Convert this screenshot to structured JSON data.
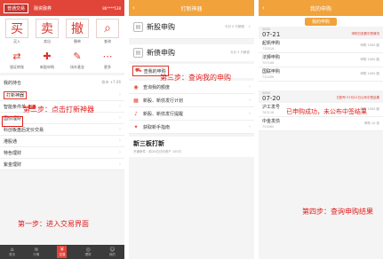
{
  "panel1": {
    "tabs": [
      "普通交易",
      "融资融券"
    ],
    "account": "86****538",
    "grid": [
      {
        "label": "买入",
        "char": "买",
        "icon": "buy-icon",
        "big": true
      },
      {
        "label": "卖出",
        "char": "卖",
        "icon": "sell-icon",
        "big": true
      },
      {
        "label": "撤单",
        "char": "撤",
        "icon": "cancel-order-icon",
        "big": true
      },
      {
        "label": "查询",
        "char": "⌕",
        "icon": "search-icon",
        "big": true
      },
      {
        "label": "银证转账",
        "char": "⇄",
        "icon": "transfer-icon",
        "big": false
      },
      {
        "label": "新股申购",
        "char": "✚",
        "icon": "ipo-icon",
        "big": false
      },
      {
        "label": "场外基金",
        "char": "✎",
        "icon": "fund-icon",
        "big": false
      },
      {
        "label": "更多",
        "char": "⋯",
        "icon": "more-icon",
        "big": false
      }
    ],
    "holding_title": "我的持仓",
    "holding_value": "收市 +7.06",
    "rows": [
      {
        "label": "打新神器",
        "sub": "",
        "tag": "",
        "boxed": true
      },
      {
        "label": "智能条件单",
        "sub": "",
        "tag": "新",
        "boxed": false
      },
      {
        "label": "国债理财",
        "sub": "",
        "tag": "",
        "boxed": false
      },
      {
        "label": "科创板盘后定价交易",
        "sub": "",
        "tag": "",
        "boxed": false
      },
      {
        "label": "港股通",
        "sub": "",
        "tag": "",
        "boxed": false
      },
      {
        "label": "特色理财",
        "sub": "",
        "tag": "",
        "boxed": false
      },
      {
        "label": "紫金理财",
        "sub": "",
        "tag": "",
        "boxed": false
      }
    ],
    "bottom_nav": [
      {
        "label": "首页",
        "icon": "home-icon",
        "active": false
      },
      {
        "label": "行情",
        "icon": "market-icon",
        "active": false
      },
      {
        "label": "交易",
        "icon": "trade-icon",
        "active": true
      },
      {
        "label": "理财",
        "icon": "finance-icon",
        "active": false
      },
      {
        "label": "我的",
        "icon": "user-icon",
        "active": false
      }
    ]
  },
  "panel2": {
    "title": "打新神器",
    "cards": [
      {
        "name": "新股申购",
        "meta": "今日 0 只新股"
      },
      {
        "name": "新债申购",
        "meta": "今日 3 只新债"
      }
    ],
    "query_label": "查我的申购",
    "list": [
      {
        "label": "查询我的额度",
        "icon": "quota-icon"
      },
      {
        "label": "新股、新债发行计划",
        "icon": "calendar-icon"
      },
      {
        "label": "新股、新债发行提醒",
        "icon": "bell-icon"
      },
      {
        "label": "获取新手指南",
        "icon": "guide-icon"
      }
    ],
    "board_title": "新三板打新",
    "board_sub": "开通条件 · 前20日日均资产 100万"
  },
  "panel3": {
    "title": "我的申购",
    "tab": "我的申购",
    "groups": [
      {
        "year": "2020",
        "date": "07-21",
        "note": "申购日查看中签情况",
        "items": [
          {
            "name": "起帆申购",
            "code": "732516",
            "right": "申购 1000 股"
          },
          {
            "name": "法狮申购",
            "code": "707166",
            "right": "申购 1000 股"
          },
          {
            "name": "国联申购",
            "code": "732456",
            "right": "申购 1000 股"
          }
        ],
        "badge": "中签结果将于2020.07.23公布"
      },
      {
        "year": "2020",
        "date": "07-20",
        "note": "已配号 07月22日公布中签结果",
        "items": [
          {
            "name": "沪工发号",
            "code": "783118",
            "right": "申购 1000 股"
          },
          {
            "name": "中金发债",
            "code": "754060",
            "right": "申购 10 张"
          }
        ],
        "badge": ""
      }
    ]
  },
  "annotations": {
    "step1": "第一步：进入交易界面",
    "step2": "第二步：点击打新神器",
    "step3": "第三步：查询我的申购",
    "step4": "第四步：查询申购结果",
    "result": "已申购成功，未公布中签结果"
  },
  "colors": {
    "red": "#e1453a",
    "orange": "#f1a23a",
    "annotation": "#e01c1c"
  }
}
